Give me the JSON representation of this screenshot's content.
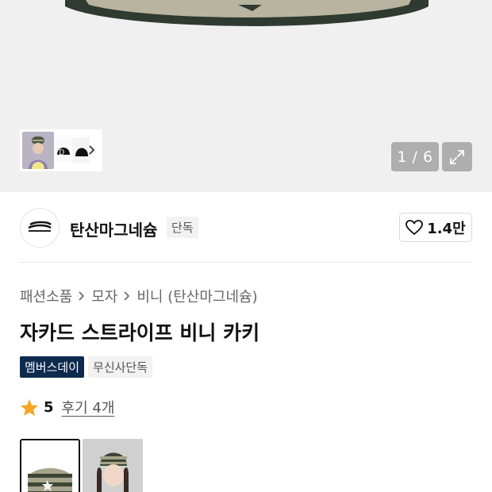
{
  "gallery": {
    "pager_current": "1",
    "pager_total": "6",
    "pager_text": "1 / 6"
  },
  "brand": {
    "name": "탄산마그네슘",
    "exclusive_tag": "단독",
    "likes": "1.4만"
  },
  "breadcrumb": [
    "패션소품",
    "모자",
    "비니 (탄산마그네슘)"
  ],
  "product": {
    "title": "자카드 스트라이프 비니 카키",
    "tags": {
      "member": "멤버스데이",
      "exclusive": "무신사단독"
    },
    "rating": "5",
    "review_label": "후기 4개"
  },
  "icons": {
    "expand": "expand-icon",
    "heart": "heart-icon",
    "star": "star-icon",
    "chevron": "chevron-right-icon"
  },
  "colors": {
    "member_tag_bg": "#0d2a4f",
    "star": "#f5a623"
  }
}
